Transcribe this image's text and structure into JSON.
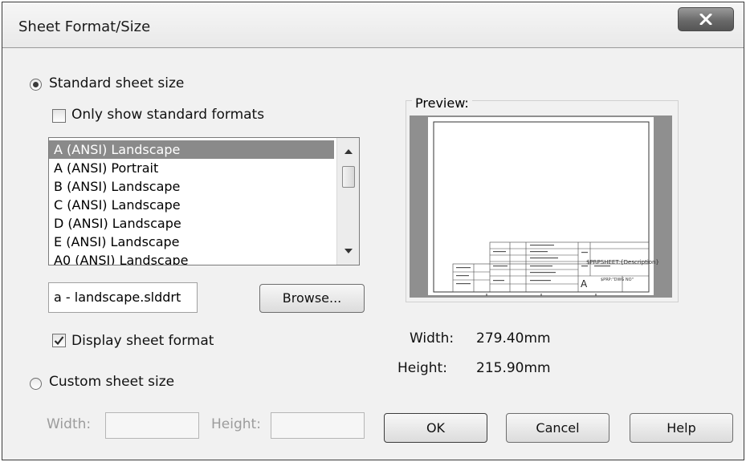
{
  "window": {
    "title": "Sheet Format/Size"
  },
  "standard": {
    "radio_label": "Standard sheet size",
    "only_standard_label": "Only show standard formats",
    "sizes": [
      "A (ANSI) Landscape",
      "A (ANSI) Portrait",
      "B (ANSI) Landscape",
      "C (ANSI) Landscape",
      "D (ANSI) Landscape",
      "E (ANSI) Landscape",
      "A0 (ANSI) Landscape"
    ],
    "selected_size": "A (ANSI) Landscape",
    "format_file": "a - landscape.slddrt",
    "browse_label": "Browse...",
    "display_format_label": "Display sheet format"
  },
  "custom": {
    "radio_label": "Custom sheet size",
    "width_label": "Width:",
    "height_label": "Height:"
  },
  "preview": {
    "label": "Preview:",
    "title_block_text": "$PRPSHEET:{Description}",
    "size_letter": "A",
    "dwg_text": "$PRP:\"DWG NO\"",
    "width_label": "Width:",
    "width_value": "279.40mm",
    "height_label": "Height:",
    "height_value": "215.90mm"
  },
  "buttons": {
    "ok": "OK",
    "cancel": "Cancel",
    "help": "Help"
  }
}
